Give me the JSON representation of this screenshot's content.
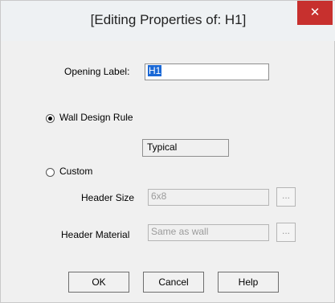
{
  "window": {
    "title": "[Editing Properties of: H1]",
    "close_glyph": "✕"
  },
  "opening_label": {
    "label": "Opening Label:",
    "value": "H1"
  },
  "wall_design_rule": {
    "label": "Wall Design Rule",
    "value": "Typical",
    "selected": true
  },
  "custom": {
    "label": "Custom",
    "selected": false
  },
  "header_size": {
    "label": "Header Size",
    "value": "6x8",
    "browse": "..."
  },
  "header_material": {
    "label": "Header Material",
    "value": "Same as wall",
    "browse": "..."
  },
  "buttons": {
    "ok": "OK",
    "cancel": "Cancel",
    "help": "Help"
  }
}
